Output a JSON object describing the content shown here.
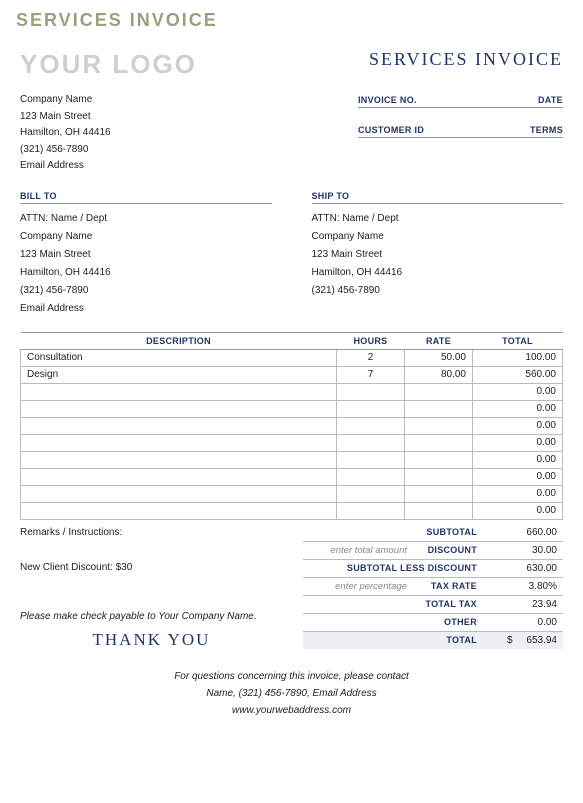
{
  "headerTitle": "SERVICES INVOICE",
  "logo": "YOUR LOGO",
  "docTitle": "SERVICES INVOICE",
  "from": {
    "company": "Company Name",
    "street": "123 Main Street",
    "city": "Hamilton, OH  44416",
    "phone": "(321) 456-7890",
    "email": "Email Address"
  },
  "meta": {
    "invoiceNoLabel": "INVOICE NO.",
    "dateLabel": "DATE",
    "customerIdLabel": "CUSTOMER ID",
    "termsLabel": "TERMS"
  },
  "billToLabel": "BILL TO",
  "shipToLabel": "SHIP TO",
  "billTo": {
    "attn": "ATTN: Name / Dept",
    "company": "Company Name",
    "street": "123 Main Street",
    "city": "Hamilton, OH  44416",
    "phone": "(321) 456-7890",
    "email": "Email Address"
  },
  "shipTo": {
    "attn": "ATTN: Name / Dept",
    "company": "Company Name",
    "street": "123 Main Street",
    "city": "Hamilton, OH  44416",
    "phone": "(321) 456-7890"
  },
  "columns": {
    "desc": "DESCRIPTION",
    "hours": "HOURS",
    "rate": "RATE",
    "total": "TOTAL"
  },
  "rows": [
    {
      "desc": "Consultation",
      "hours": "2",
      "rate": "50.00",
      "total": "100.00"
    },
    {
      "desc": "Design",
      "hours": "7",
      "rate": "80.00",
      "total": "560.00"
    },
    {
      "desc": "",
      "hours": "",
      "rate": "",
      "total": "0.00"
    },
    {
      "desc": "",
      "hours": "",
      "rate": "",
      "total": "0.00"
    },
    {
      "desc": "",
      "hours": "",
      "rate": "",
      "total": "0.00"
    },
    {
      "desc": "",
      "hours": "",
      "rate": "",
      "total": "0.00"
    },
    {
      "desc": "",
      "hours": "",
      "rate": "",
      "total": "0.00"
    },
    {
      "desc": "",
      "hours": "",
      "rate": "",
      "total": "0.00"
    },
    {
      "desc": "",
      "hours": "",
      "rate": "",
      "total": "0.00"
    },
    {
      "desc": "",
      "hours": "",
      "rate": "",
      "total": "0.00"
    }
  ],
  "remarksLabel": "Remarks / Instructions:",
  "remarksNote": "New Client Discount: $30",
  "payableText": "Please make check payable to Your Company Name.",
  "thankYou": "THANK YOU",
  "totals": {
    "subtotalLabel": "SUBTOTAL",
    "subtotal": "660.00",
    "discountHint": "enter total amount",
    "discountLabel": "DISCOUNT",
    "discount": "30.00",
    "lessLabel": "SUBTOTAL LESS DISCOUNT",
    "less": "630.00",
    "taxHint": "enter percentage",
    "taxRateLabel": "TAX RATE",
    "taxRate": "3.80%",
    "totalTaxLabel": "TOTAL TAX",
    "totalTax": "23.94",
    "otherLabel": "OTHER",
    "other": "0.00",
    "totalLabel": "TOTAL",
    "currency": "$",
    "total": "653.94"
  },
  "footer": {
    "line1": "For questions concerning this invoice, please contact",
    "line2": "Name, (321) 456-7890, Email Address",
    "line3": "www.yourwebaddress.com"
  }
}
